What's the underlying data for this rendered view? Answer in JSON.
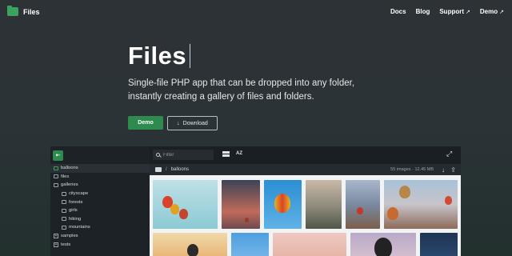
{
  "app": {
    "name": "Files"
  },
  "nav": [
    {
      "label": "Docs",
      "external": false
    },
    {
      "label": "Blog",
      "external": false
    },
    {
      "label": "Support",
      "external": true
    },
    {
      "label": "Demo",
      "external": true
    }
  ],
  "hero": {
    "title": "Files",
    "subtitle": "Single-file PHP app that can be dropped into any folder, instantly creating a gallery of files and folders.",
    "demo_button": "Demo",
    "download_button": "Download"
  },
  "icons": {
    "external": "↗",
    "download": "↓",
    "sidebar_toggle": "⇤",
    "sort": "AZ",
    "fullscreen": "⤢",
    "upload": "⇪"
  },
  "colors": {
    "accent": "#2f8a4f",
    "folder": "#3aa35e"
  },
  "demo_app": {
    "filter_placeholder": "Filter",
    "breadcrumb": {
      "separator": "/",
      "current": "balloons"
    },
    "summary": {
      "count": "55 images",
      "size": "12.45 MB"
    },
    "tree": [
      {
        "label": "balloons",
        "level": 0,
        "active": true,
        "expander": false
      },
      {
        "label": "files",
        "level": 0,
        "active": false,
        "expander": false
      },
      {
        "label": "galleries",
        "level": 0,
        "active": false,
        "expander": false
      },
      {
        "label": "cityscape",
        "level": 1,
        "active": false,
        "expander": false
      },
      {
        "label": "forests",
        "level": 1,
        "active": false,
        "expander": false
      },
      {
        "label": "girls",
        "level": 1,
        "active": false,
        "expander": false
      },
      {
        "label": "hiking",
        "level": 1,
        "active": false,
        "expander": false
      },
      {
        "label": "mountains",
        "level": 1,
        "active": false,
        "expander": false
      },
      {
        "label": "samples",
        "level": 0,
        "active": false,
        "expander": true
      },
      {
        "label": "tests",
        "level": 0,
        "active": false,
        "expander": true
      }
    ]
  }
}
